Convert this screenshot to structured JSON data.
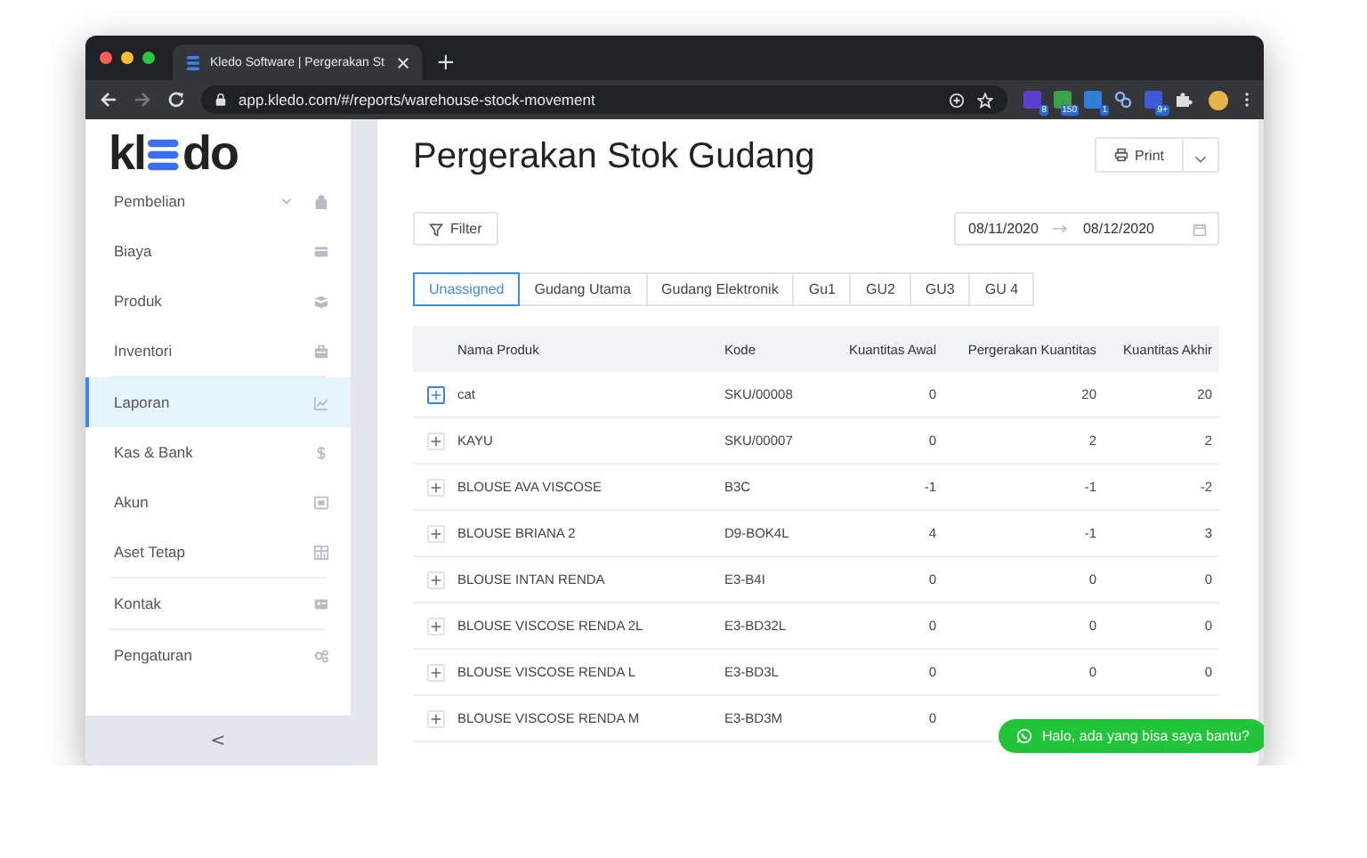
{
  "browser": {
    "tab_title": "Kledo Software | Pergerakan St",
    "new_tab": "+",
    "url": "app.kledo.com/#/reports/warehouse-stock-movement",
    "extension_badges": [
      "8",
      "150",
      "1",
      "9+"
    ]
  },
  "sidebar": {
    "items": [
      {
        "label": "Pembelian",
        "selected": false,
        "expandable": true
      },
      {
        "label": "Biaya",
        "selected": false,
        "expandable": false
      },
      {
        "label": "Produk",
        "selected": false,
        "expandable": false
      },
      {
        "label": "Inventori",
        "selected": false,
        "expandable": false,
        "divider_after": true
      },
      {
        "label": "Laporan",
        "selected": true,
        "expandable": false
      },
      {
        "label": "Kas & Bank",
        "selected": false,
        "expandable": false
      },
      {
        "label": "Akun",
        "selected": false,
        "expandable": false
      },
      {
        "label": "Aset Tetap",
        "selected": false,
        "expandable": false,
        "divider_after": true
      },
      {
        "label": "Kontak",
        "selected": false,
        "expandable": false,
        "divider_after": true
      },
      {
        "label": "Pengaturan",
        "selected": false,
        "expandable": false
      }
    ],
    "collapse": "<"
  },
  "logo": {
    "left": "kl",
    "right": "do"
  },
  "page": {
    "title": "Pergerakan Stok Gudang",
    "print": "Print",
    "filter": "Filter",
    "start_date": "08/11/2020",
    "end_date": "08/12/2020"
  },
  "tabs": [
    {
      "label": "Unassigned",
      "selected": true
    },
    {
      "label": "Gudang Utama",
      "selected": false
    },
    {
      "label": "Gudang Elektronik",
      "selected": false
    },
    {
      "label": "Gu1",
      "selected": false
    },
    {
      "label": "GU2",
      "selected": false
    },
    {
      "label": "GU3",
      "selected": false
    },
    {
      "label": "GU 4",
      "selected": false
    }
  ],
  "table": {
    "columns": [
      "Nama Produk",
      "Kode",
      "Kuantitas Awal",
      "Pergerakan Kuantitas",
      "Kuantitas Akhir"
    ],
    "rows": [
      {
        "focused": true,
        "cells": [
          "cat",
          "SKU/00008",
          "0",
          "20",
          "20"
        ]
      },
      {
        "focused": false,
        "cells": [
          "KAYU",
          "SKU/00007",
          "0",
          "2",
          "2"
        ]
      },
      {
        "focused": false,
        "cells": [
          "BLOUSE AVA VISCOSE",
          "B3C",
          "-1",
          "-1",
          "-2"
        ]
      },
      {
        "focused": false,
        "cells": [
          "BLOUSE BRIANA 2",
          "D9-BOK4L",
          "4",
          "-1",
          "3"
        ]
      },
      {
        "focused": false,
        "cells": [
          "BLOUSE INTAN RENDA",
          "E3-B4I",
          "0",
          "0",
          "0"
        ]
      },
      {
        "focused": false,
        "cells": [
          "BLOUSE VISCOSE RENDA 2L",
          "E3-BD32L",
          "0",
          "0",
          "0"
        ]
      },
      {
        "focused": false,
        "cells": [
          "BLOUSE VISCOSE RENDA L",
          "E3-BD3L",
          "0",
          "0",
          "0"
        ]
      },
      {
        "focused": false,
        "cells": [
          "BLOUSE VISCOSE RENDA M",
          "E3-BD3M",
          "0"
        ]
      }
    ]
  },
  "chat": {
    "label": "Halo, ada yang bisa saya bantu?"
  }
}
